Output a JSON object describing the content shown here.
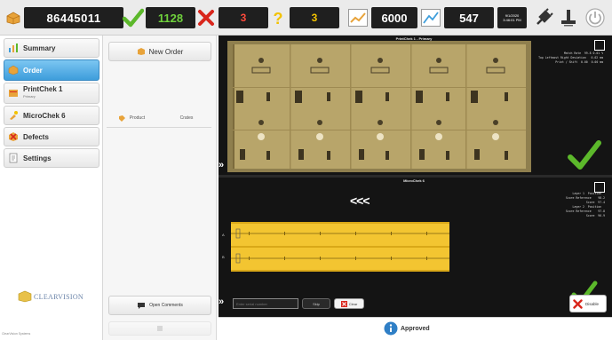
{
  "topbar": {
    "order_number": "86445011",
    "approved_count": "1128",
    "rejected_count": "3",
    "unknown_count": "3",
    "speed_value": "6000",
    "sheet_value": "547",
    "datetime_line1": "9/1/2020",
    "datetime_line2": "3:46:01 PM",
    "colors": {
      "ok": "#5cb82b",
      "reject": "#d9261c",
      "warn": "#f2c200",
      "dark": "#1f1f1f"
    }
  },
  "sidebar": {
    "items": [
      {
        "label": "Summary",
        "sub": "",
        "icon": "summary-icon"
      },
      {
        "label": "Order",
        "sub": "",
        "icon": "order-icon"
      },
      {
        "label": "PrintChek 1",
        "sub": "Primary",
        "icon": "printchek-icon"
      },
      {
        "label": "MicroChek 6",
        "sub": "",
        "icon": "microchek-icon"
      },
      {
        "label": "Defects",
        "sub": "",
        "icon": "defects-icon"
      },
      {
        "label": "Settings",
        "sub": "",
        "icon": "settings-icon"
      }
    ],
    "logo_text": "CLEARVISION",
    "footer_text": "ClearVision Systems"
  },
  "middle": {
    "new_order_label": "New Order",
    "tabs": [
      "Product",
      "Crates"
    ],
    "open_comments_label": "Open Comments"
  },
  "camera1": {
    "title": "PrintChek 1 - Primary",
    "info": "Match Rate  99.8 0.01 %\nTop Leftmost Right Deviation   0.02 mm\nPrint / Shift  0.00  0.00 mm"
  },
  "camera2": {
    "title": "MicroChek 6",
    "info": "Layer 1  Position  \nScore Reference    98.2\nScore  97.4\nLayer 2  Position  \nScore Reference    97.8\nScore  96.9"
  },
  "controls": {
    "input_placeholder": "Enter serial number",
    "skip_label": "Skip",
    "clear_label": "Clear",
    "disable_label": "Disable",
    "arrows": "<<<",
    "chevrons": "»",
    "lane_labels": [
      "A",
      "B"
    ]
  },
  "status": {
    "label": "Approved"
  }
}
